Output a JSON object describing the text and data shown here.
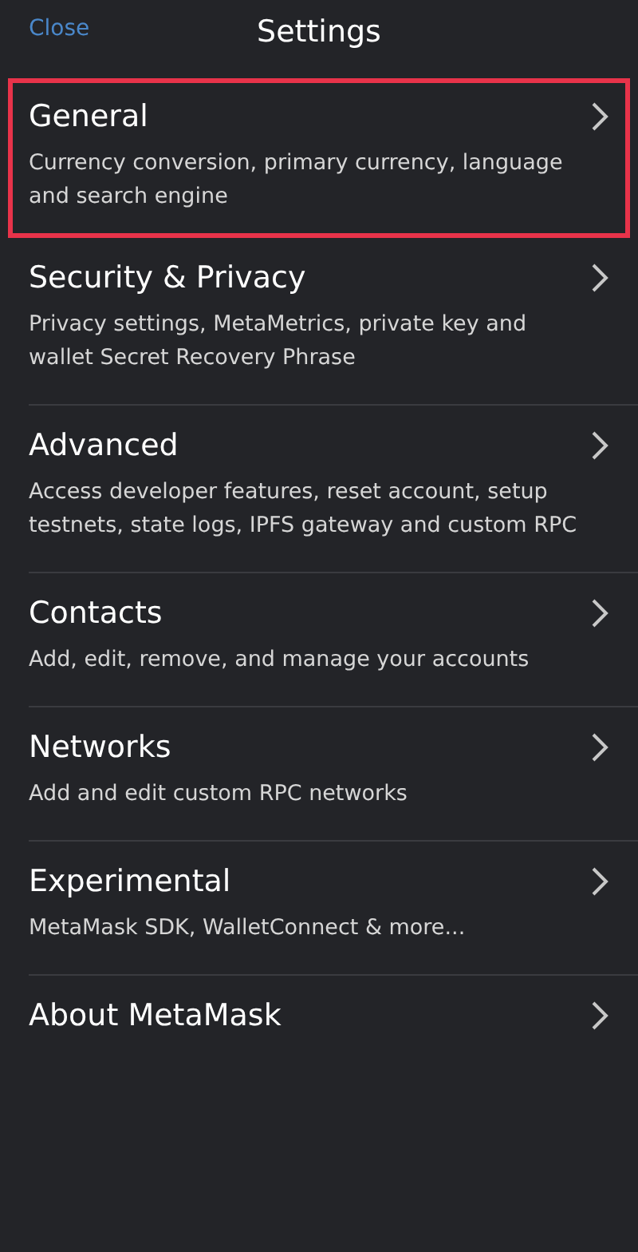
{
  "header": {
    "close": "Close",
    "title": "Settings"
  },
  "items": [
    {
      "title": "General",
      "description": "Currency conversion, primary currency, language and search engine",
      "highlighted": true
    },
    {
      "title": "Security & Privacy",
      "description": "Privacy settings, MetaMetrics, private key and wallet Secret Recovery Phrase",
      "highlighted": false
    },
    {
      "title": "Advanced",
      "description": "Access developer features, reset account, setup testnets, state logs, IPFS gateway and custom RPC",
      "highlighted": false
    },
    {
      "title": "Contacts",
      "description": "Add, edit, remove, and manage your accounts",
      "highlighted": false
    },
    {
      "title": "Networks",
      "description": "Add and edit custom RPC networks",
      "highlighted": false
    },
    {
      "title": "Experimental",
      "description": "MetaMask SDK, WalletConnect & more...",
      "highlighted": false
    },
    {
      "title": "About MetaMask",
      "highlighted": false
    }
  ]
}
